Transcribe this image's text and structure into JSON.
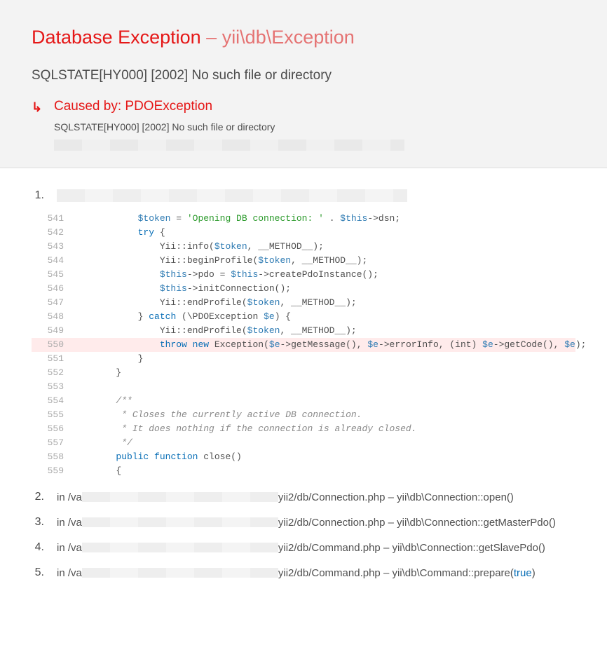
{
  "header": {
    "title_main": "Database Exception",
    "title_dash": " – ",
    "title_link": "yii\\db\\Exception",
    "message": "SQLSTATE[HY000] [2002] No such file or directory",
    "caused_by": "Caused by: PDOException",
    "caused_msg": "SQLSTATE[HY000] [2002] No such file or directory"
  },
  "trace": {
    "item1": {
      "num": "1."
    },
    "item2": {
      "num": "2.",
      "prefix": "in /va",
      "suffix": "yii2/db/Connection.php",
      "sep": " – ",
      "method": "yii\\db\\Connection::open()"
    },
    "item3": {
      "num": "3.",
      "prefix": "in /va",
      "suffix": "yii2/db/Connection.php",
      "sep": " – ",
      "method": "yii\\db\\Connection::getMasterPdo()"
    },
    "item4": {
      "num": "4.",
      "prefix": "in /va",
      "suffix": "yii2/db/Command.php",
      "sep": " – ",
      "method": "yii\\db\\Connection::getSlavePdo()"
    },
    "item5": {
      "num": "5.",
      "prefix": "in /va",
      "suffix": "yii2/db/Command.php",
      "sep": " – ",
      "method": "yii\\db\\Command::prepare(",
      "arg": "true",
      "close": ")"
    }
  },
  "code": {
    "l541": {
      "n": "541"
    },
    "l542": {
      "n": "542"
    },
    "l543": {
      "n": "543"
    },
    "l544": {
      "n": "544"
    },
    "l545": {
      "n": "545"
    },
    "l546": {
      "n": "546"
    },
    "l547": {
      "n": "547"
    },
    "l548": {
      "n": "548"
    },
    "l549": {
      "n": "549"
    },
    "l550": {
      "n": "550"
    },
    "l551": {
      "n": "551"
    },
    "l552": {
      "n": "552"
    },
    "l553": {
      "n": "553"
    },
    "l554": {
      "n": "554"
    },
    "l555": {
      "n": "555"
    },
    "l556": {
      "n": "556"
    },
    "l557": {
      "n": "557"
    },
    "l558": {
      "n": "558"
    },
    "l559": {
      "n": "559"
    },
    "tok": {
      "token": "$token",
      "eq": " = ",
      "str1": "'Opening DB connection: '",
      "dot": " . ",
      "this": "$this",
      "arrow_dsn": "->dsn;",
      "try": "            try",
      "brace_open": " {",
      "yii_info": "                Yii::info(",
      "comma_method": ", __METHOD__);",
      "yii_begin": "                Yii::beginProfile(",
      "this_pdo": "->pdo = ",
      "create_pdo": "->createPdoInstance();",
      "init_conn": "->initConnection();",
      "yii_end": "                Yii::endProfile(",
      "catch": "catch",
      "catch_paren": " (\\PDOException ",
      "e": "$e",
      "paren_brace": ") {",
      "throw": "throw",
      "new": " new",
      "exc": " Exception(",
      "get_msg": "->getMessage(), ",
      "err_info": "->errorInfo, (int) ",
      "get_code": "->getCode(), ",
      "close_semi": ");",
      "brace_c1": "            }",
      "brace_c2": "        }",
      "empty": "",
      "com1": "        /**",
      "com2": "         * Closes the currently active DB connection.",
      "com3": "         * It does nothing if the connection is already closed.",
      "com4": "         */",
      "public": "public",
      "func": " function",
      "close_fn": " close()",
      "brace_o": "        {",
      "pad12": "            ",
      "pad16": "                "
    }
  }
}
